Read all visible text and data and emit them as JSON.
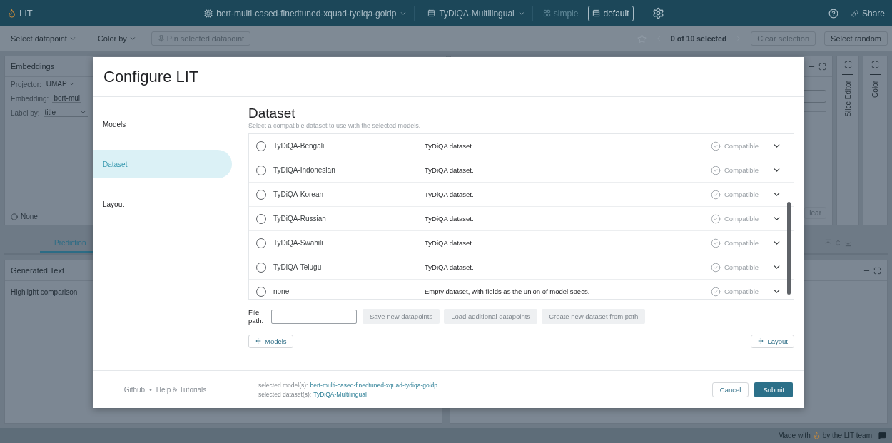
{
  "app_bar": {
    "title": "LIT",
    "model": "bert-multi-cased-finedtuned-xquad-tydiqa-goldp",
    "dataset": "TyDiQA-Multilingual",
    "layouts": [
      {
        "label": "simple",
        "selected": false
      },
      {
        "label": "default",
        "selected": true
      }
    ],
    "share": "Share"
  },
  "toolbar": {
    "select_datapoint": "Select datapoint",
    "color_by": "Color by",
    "pin": {
      "label": "Pin selected datapoint",
      "disabled": true
    },
    "selection_count": "0 of 10 selected",
    "clear_selection": {
      "label": "Clear selection",
      "disabled": true
    },
    "select_random": {
      "label": "Select random",
      "disabled": false
    }
  },
  "embeddings_panel": {
    "title": "Embeddings",
    "projector_label": "Projector:",
    "projector": "UMAP",
    "embedding_label": "Embedding:",
    "embedding": "bert-mul",
    "label_by_label": "Label by:",
    "label_by": "title",
    "legend": "None"
  },
  "right_panels": {
    "clear": "lear",
    "side_tabs": [
      "Slice Editor",
      "Color"
    ]
  },
  "lower": {
    "tabs": [
      {
        "label": "Prediction",
        "selected": true
      }
    ],
    "panel_title": "Generated Text",
    "highlight": "Highlight comparison"
  },
  "modal": {
    "title": "Configure LIT",
    "nav": [
      {
        "label": "Models",
        "selected": false
      },
      {
        "label": "Dataset",
        "selected": true
      },
      {
        "label": "Layout",
        "selected": false
      }
    ],
    "links": [
      "Github",
      "Help & Tutorials"
    ],
    "link_separator": "•",
    "section_title": "Dataset",
    "section_subtitle": "Select a compatible dataset to use with the selected models.",
    "datasets": [
      {
        "name": "TyDiQA-Bengali",
        "description": "TyDiQA dataset.",
        "status": "Compatible",
        "selected": false
      },
      {
        "name": "TyDiQA-Indonesian",
        "description": "TyDiQA dataset.",
        "status": "Compatible",
        "selected": false
      },
      {
        "name": "TyDiQA-Korean",
        "description": "TyDiQA dataset.",
        "status": "Compatible",
        "selected": false
      },
      {
        "name": "TyDiQA-Russian",
        "description": "TyDiQA dataset.",
        "status": "Compatible",
        "selected": false
      },
      {
        "name": "TyDiQA-Swahili",
        "description": "TyDiQA dataset.",
        "status": "Compatible",
        "selected": false
      },
      {
        "name": "TyDiQA-Telugu",
        "description": "TyDiQA dataset.",
        "status": "Compatible",
        "selected": false
      },
      {
        "name": "none",
        "description": "Empty dataset, with fields as the union of model specs.",
        "status": "Compatible",
        "selected": false
      }
    ],
    "file_path_label": "File path:",
    "actions": [
      {
        "label": "Save new datapoints",
        "disabled": true
      },
      {
        "label": "Load additional datapoints",
        "disabled": true
      },
      {
        "label": "Create new dataset from path",
        "disabled": true
      }
    ],
    "back": "Models",
    "next": "Layout",
    "selected_models_label": "selected model(s):",
    "selected_models": "bert-multi-cased-finedtuned-xquad-tydiqa-goldp",
    "selected_datasets_label": "selected dataset(s):",
    "selected_datasets": "TyDiQA-Multilingual",
    "cancel": "Cancel",
    "submit": "Submit"
  },
  "footer": {
    "made_with": "Made with",
    "by": "by the LIT team"
  }
}
